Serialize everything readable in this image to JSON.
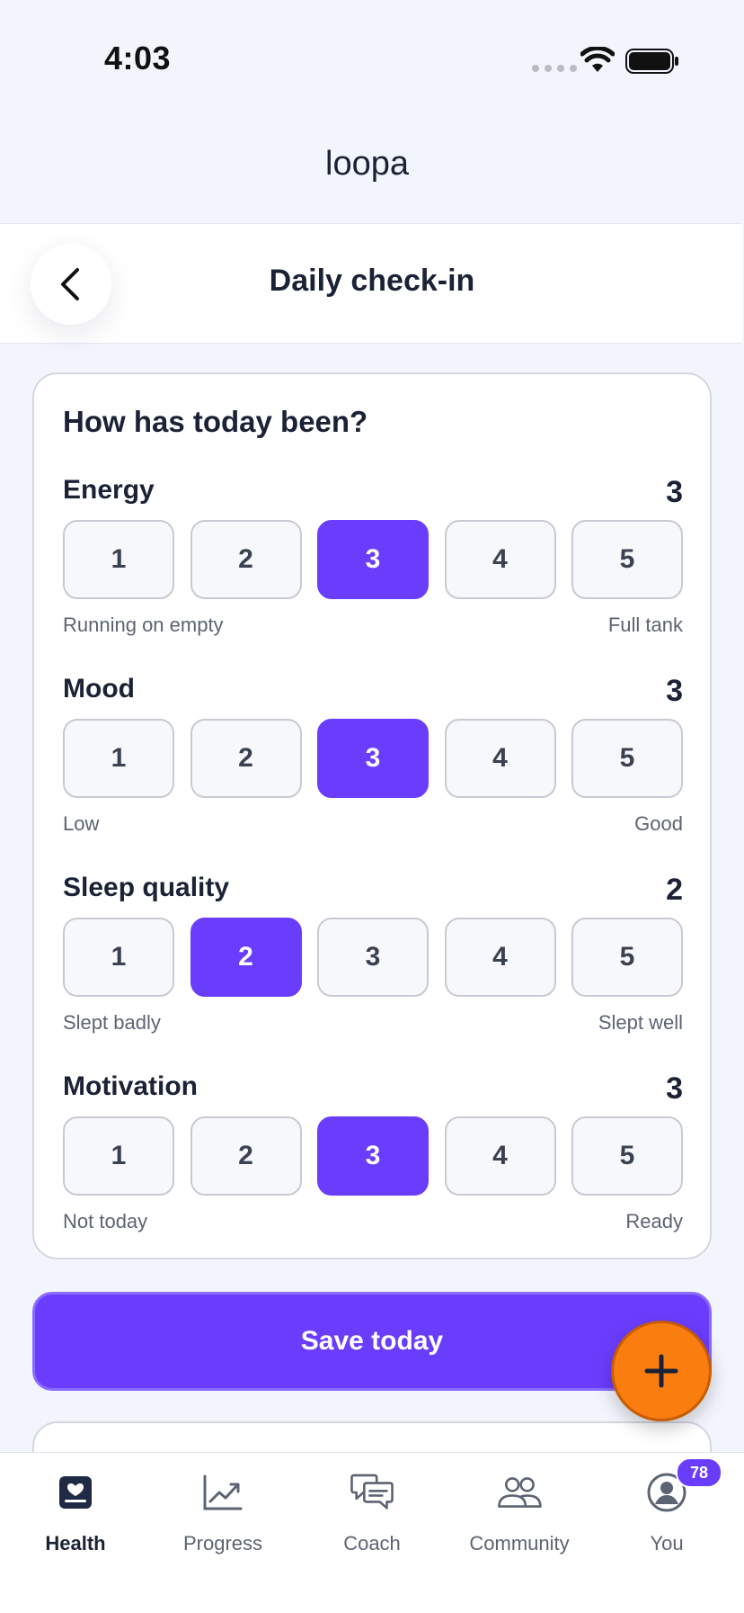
{
  "status_bar": {
    "time": "4:03"
  },
  "app": {
    "logo": "loopa"
  },
  "header": {
    "title": "Daily check-in"
  },
  "card": {
    "question": "How has today been?",
    "metrics": [
      {
        "label": "Energy",
        "value": "3",
        "options": [
          "1",
          "2",
          "3",
          "4",
          "5"
        ],
        "selected": 3,
        "low_label": "Running on empty",
        "high_label": "Full tank"
      },
      {
        "label": "Mood",
        "value": "3",
        "options": [
          "1",
          "2",
          "3",
          "4",
          "5"
        ],
        "selected": 3,
        "low_label": "Low",
        "high_label": "Good"
      },
      {
        "label": "Sleep quality",
        "value": "2",
        "options": [
          "1",
          "2",
          "3",
          "4",
          "5"
        ],
        "selected": 2,
        "low_label": "Slept badly",
        "high_label": "Slept well"
      },
      {
        "label": "Motivation",
        "value": "3",
        "options": [
          "1",
          "2",
          "3",
          "4",
          "5"
        ],
        "selected": 3,
        "low_label": "Not today",
        "high_label": "Ready"
      }
    ]
  },
  "actions": {
    "save_label": "Save today",
    "fab_icon": "plus-icon"
  },
  "bottom_nav": {
    "items": [
      {
        "label": "Health",
        "icon": "health-icon",
        "active": true
      },
      {
        "label": "Progress",
        "icon": "progress-chart-icon",
        "active": false
      },
      {
        "label": "Coach",
        "icon": "chat-bubbles-icon",
        "active": false
      },
      {
        "label": "Community",
        "icon": "people-icon",
        "active": false
      },
      {
        "label": "You",
        "icon": "profile-icon",
        "active": false
      }
    ],
    "you_badge": "78"
  },
  "colors": {
    "accent": "#6a3dfd",
    "fab": "#fa7d0f",
    "background": "#f2f5fd"
  }
}
